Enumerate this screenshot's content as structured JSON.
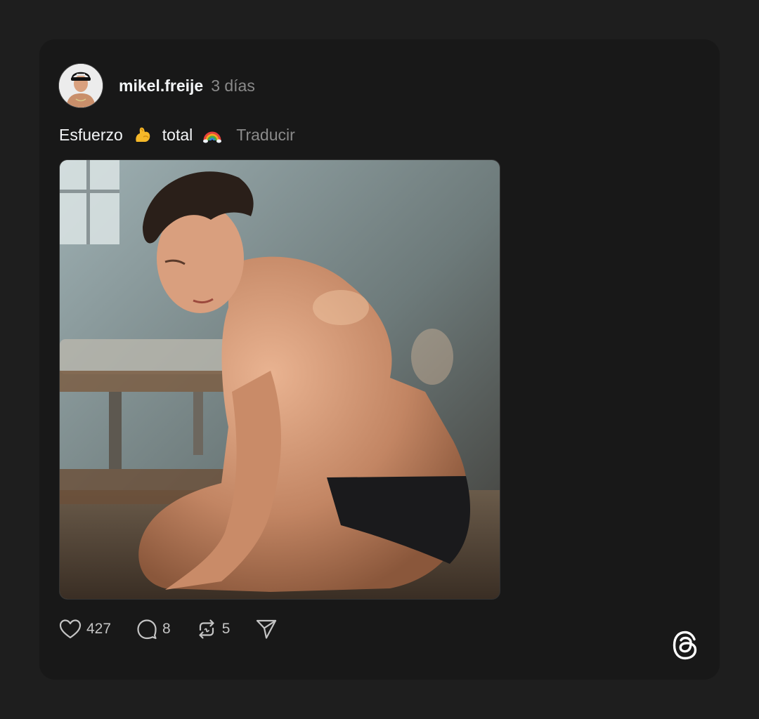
{
  "post": {
    "author": {
      "username": "mikel.freije",
      "avatar_icon": "profile-photo"
    },
    "time_ago": "3 días",
    "caption": {
      "part1": "Esfuerzo",
      "emoji1": "flexed-biceps",
      "part2": "total",
      "emoji2": "rainbow",
      "translate_label": "Traducir"
    },
    "image": {
      "description_icon": "post-photo"
    },
    "actions": {
      "likes": "427",
      "comments": "8",
      "reposts": "5",
      "share_icon": "send-icon"
    }
  },
  "brand": {
    "logo": "threads-logo"
  },
  "colors": {
    "background": "#1e1e1e",
    "card": "#181818",
    "text": "#f3f5f7",
    "muted": "#8a8a8a",
    "icon": "#c4c4c4"
  }
}
